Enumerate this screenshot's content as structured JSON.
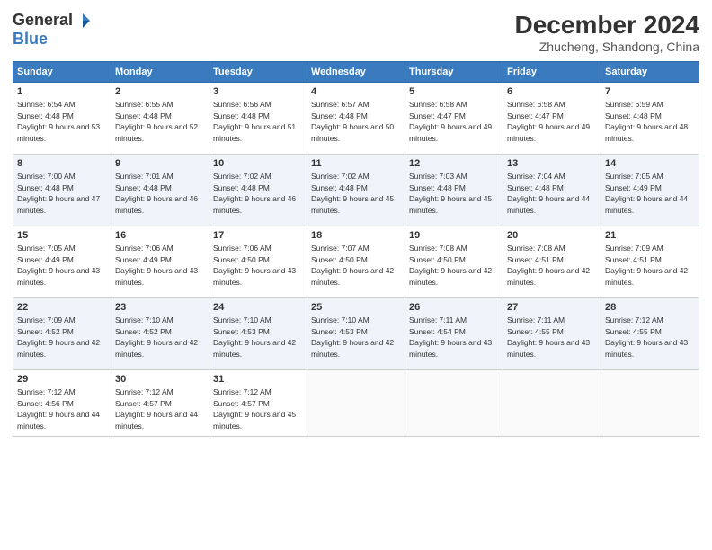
{
  "header": {
    "logo_general": "General",
    "logo_blue": "Blue",
    "month_title": "December 2024",
    "location": "Zhucheng, Shandong, China"
  },
  "weekdays": [
    "Sunday",
    "Monday",
    "Tuesday",
    "Wednesday",
    "Thursday",
    "Friday",
    "Saturday"
  ],
  "weeks": [
    [
      {
        "day": "1",
        "sunrise": "6:54 AM",
        "sunset": "4:48 PM",
        "daylight": "9 hours and 53 minutes."
      },
      {
        "day": "2",
        "sunrise": "6:55 AM",
        "sunset": "4:48 PM",
        "daylight": "9 hours and 52 minutes."
      },
      {
        "day": "3",
        "sunrise": "6:56 AM",
        "sunset": "4:48 PM",
        "daylight": "9 hours and 51 minutes."
      },
      {
        "day": "4",
        "sunrise": "6:57 AM",
        "sunset": "4:48 PM",
        "daylight": "9 hours and 50 minutes."
      },
      {
        "day": "5",
        "sunrise": "6:58 AM",
        "sunset": "4:47 PM",
        "daylight": "9 hours and 49 minutes."
      },
      {
        "day": "6",
        "sunrise": "6:58 AM",
        "sunset": "4:47 PM",
        "daylight": "9 hours and 49 minutes."
      },
      {
        "day": "7",
        "sunrise": "6:59 AM",
        "sunset": "4:48 PM",
        "daylight": "9 hours and 48 minutes."
      }
    ],
    [
      {
        "day": "8",
        "sunrise": "7:00 AM",
        "sunset": "4:48 PM",
        "daylight": "9 hours and 47 minutes."
      },
      {
        "day": "9",
        "sunrise": "7:01 AM",
        "sunset": "4:48 PM",
        "daylight": "9 hours and 46 minutes."
      },
      {
        "day": "10",
        "sunrise": "7:02 AM",
        "sunset": "4:48 PM",
        "daylight": "9 hours and 46 minutes."
      },
      {
        "day": "11",
        "sunrise": "7:02 AM",
        "sunset": "4:48 PM",
        "daylight": "9 hours and 45 minutes."
      },
      {
        "day": "12",
        "sunrise": "7:03 AM",
        "sunset": "4:48 PM",
        "daylight": "9 hours and 45 minutes."
      },
      {
        "day": "13",
        "sunrise": "7:04 AM",
        "sunset": "4:48 PM",
        "daylight": "9 hours and 44 minutes."
      },
      {
        "day": "14",
        "sunrise": "7:05 AM",
        "sunset": "4:49 PM",
        "daylight": "9 hours and 44 minutes."
      }
    ],
    [
      {
        "day": "15",
        "sunrise": "7:05 AM",
        "sunset": "4:49 PM",
        "daylight": "9 hours and 43 minutes."
      },
      {
        "day": "16",
        "sunrise": "7:06 AM",
        "sunset": "4:49 PM",
        "daylight": "9 hours and 43 minutes."
      },
      {
        "day": "17",
        "sunrise": "7:06 AM",
        "sunset": "4:50 PM",
        "daylight": "9 hours and 43 minutes."
      },
      {
        "day": "18",
        "sunrise": "7:07 AM",
        "sunset": "4:50 PM",
        "daylight": "9 hours and 42 minutes."
      },
      {
        "day": "19",
        "sunrise": "7:08 AM",
        "sunset": "4:50 PM",
        "daylight": "9 hours and 42 minutes."
      },
      {
        "day": "20",
        "sunrise": "7:08 AM",
        "sunset": "4:51 PM",
        "daylight": "9 hours and 42 minutes."
      },
      {
        "day": "21",
        "sunrise": "7:09 AM",
        "sunset": "4:51 PM",
        "daylight": "9 hours and 42 minutes."
      }
    ],
    [
      {
        "day": "22",
        "sunrise": "7:09 AM",
        "sunset": "4:52 PM",
        "daylight": "9 hours and 42 minutes."
      },
      {
        "day": "23",
        "sunrise": "7:10 AM",
        "sunset": "4:52 PM",
        "daylight": "9 hours and 42 minutes."
      },
      {
        "day": "24",
        "sunrise": "7:10 AM",
        "sunset": "4:53 PM",
        "daylight": "9 hours and 42 minutes."
      },
      {
        "day": "25",
        "sunrise": "7:10 AM",
        "sunset": "4:53 PM",
        "daylight": "9 hours and 42 minutes."
      },
      {
        "day": "26",
        "sunrise": "7:11 AM",
        "sunset": "4:54 PM",
        "daylight": "9 hours and 43 minutes."
      },
      {
        "day": "27",
        "sunrise": "7:11 AM",
        "sunset": "4:55 PM",
        "daylight": "9 hours and 43 minutes."
      },
      {
        "day": "28",
        "sunrise": "7:12 AM",
        "sunset": "4:55 PM",
        "daylight": "9 hours and 43 minutes."
      }
    ],
    [
      {
        "day": "29",
        "sunrise": "7:12 AM",
        "sunset": "4:56 PM",
        "daylight": "9 hours and 44 minutes."
      },
      {
        "day": "30",
        "sunrise": "7:12 AM",
        "sunset": "4:57 PM",
        "daylight": "9 hours and 44 minutes."
      },
      {
        "day": "31",
        "sunrise": "7:12 AM",
        "sunset": "4:57 PM",
        "daylight": "9 hours and 45 minutes."
      },
      null,
      null,
      null,
      null
    ]
  ]
}
